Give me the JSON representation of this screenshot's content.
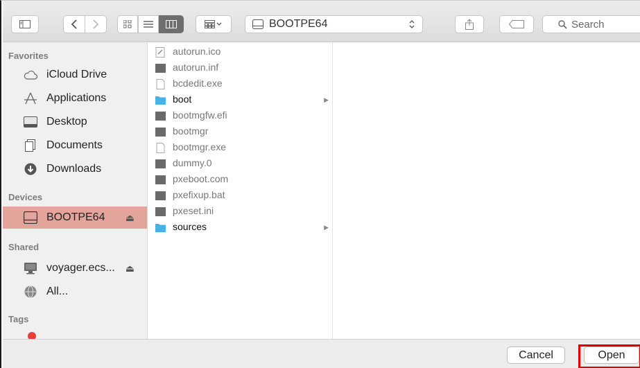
{
  "toolbar": {
    "path_label": "BOOTPE64",
    "search_placeholder": "Search"
  },
  "sidebar": {
    "sections": {
      "favorites": "Favorites",
      "devices": "Devices",
      "shared": "Shared",
      "tags": "Tags"
    },
    "favorites": [
      {
        "label": "iCloud Drive",
        "icon": "cloud-icon"
      },
      {
        "label": "Applications",
        "icon": "applications-icon"
      },
      {
        "label": "Desktop",
        "icon": "desktop-icon"
      },
      {
        "label": "Documents",
        "icon": "documents-icon"
      },
      {
        "label": "Downloads",
        "icon": "downloads-icon"
      }
    ],
    "devices": [
      {
        "label": "BOOTPE64",
        "icon": "drive-icon",
        "selected": true
      }
    ],
    "shared": [
      {
        "label": "voyager.ecs...",
        "icon": "computer-icon"
      },
      {
        "label": "All...",
        "icon": "network-icon"
      }
    ],
    "selected_color": "#e3a49b"
  },
  "files": [
    {
      "name": "autorun.ico",
      "type": "icon-file"
    },
    {
      "name": "autorun.inf",
      "type": "dark-file"
    },
    {
      "name": "bcdedit.exe",
      "type": "blank-file"
    },
    {
      "name": "boot",
      "type": "folder"
    },
    {
      "name": "bootmgfw.efi",
      "type": "dark-file"
    },
    {
      "name": "bootmgr",
      "type": "dark-file"
    },
    {
      "name": "bootmgr.exe",
      "type": "blank-file"
    },
    {
      "name": "dummy.0",
      "type": "dark-file"
    },
    {
      "name": "pxeboot.com",
      "type": "dark-file"
    },
    {
      "name": "pxefixup.bat",
      "type": "dark-file"
    },
    {
      "name": "pxeset.ini",
      "type": "dark-file"
    },
    {
      "name": "sources",
      "type": "folder"
    }
  ],
  "footer": {
    "cancel_label": "Cancel",
    "open_label": "Open"
  }
}
